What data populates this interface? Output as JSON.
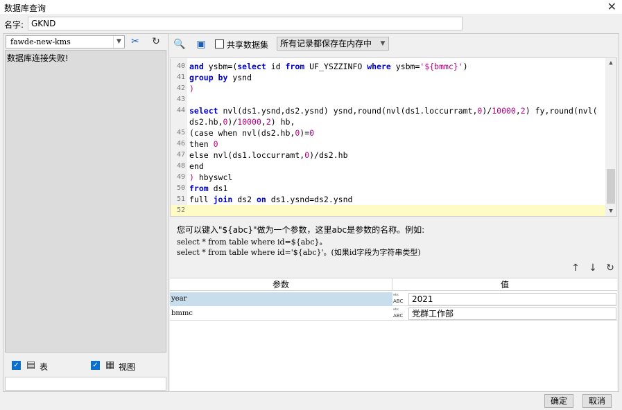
{
  "window": {
    "title": "数据库查询",
    "close_icon": "close-icon"
  },
  "name_field": {
    "label": "名字:",
    "value": "GKND"
  },
  "left": {
    "connection": "fawde-new-kms",
    "message": "数据库连接失败!",
    "table_label": "表",
    "view_label": "视图"
  },
  "toolbar": {
    "share_label": "共享数据集",
    "mode_value": "所有记录都保存在内存中"
  },
  "editor": {
    "lines": [
      {
        "n": "40",
        "html": "<span class='kw'>and</span> ysbm=(<span class='kw'>select</span> id <span class='kw'>from</span> UF_YSZZINFO <span class='kw'>where</span> ysbm=<span class='str'>'${bmmc}'</span>)"
      },
      {
        "n": "41",
        "html": "<span class='kw'>group by</span> ysnd"
      },
      {
        "n": "42",
        "html": "<span class='str'>)</span>"
      },
      {
        "n": "43",
        "html": ""
      },
      {
        "n": "44",
        "html": "<span class='kw'>select</span> nvl(ds1.ysnd,ds2.ysnd) ysnd,round(nvl(ds1.loccurramt,<span class='num'>0</span>)/<span class='num'>10000</span>,<span class='num'>2</span>) fy,round(nvl("
      },
      {
        "n": "",
        "html": "ds2.hb,<span class='num'>0</span>)/<span class='num'>10000</span>,<span class='num'>2</span>) hb,"
      },
      {
        "n": "45",
        "html": "(case when nvl(ds2.hb,<span class='num'>0</span>)=<span class='num'>0</span>"
      },
      {
        "n": "46",
        "html": "then <span class='num'>0</span>"
      },
      {
        "n": "47",
        "html": "else nvl(ds1.loccurramt,<span class='num'>0</span>)/ds2.hb"
      },
      {
        "n": "48",
        "html": "end"
      },
      {
        "n": "49",
        "html": "<span class='str'>)</span> hbyswcl"
      },
      {
        "n": "50",
        "html": "<span class='kw'>from</span> ds1"
      },
      {
        "n": "51",
        "html": "full <span class='kw'>join</span> ds2 <span class='kw'>on</span> ds1.ysnd=ds2.ysnd"
      },
      {
        "n": "52",
        "html": ""
      }
    ]
  },
  "hint": {
    "line1": "您可以键入\"${abc}\"做为一个参数，这里abc是参数的名称。例如:",
    "line2": "select * from table where id=${abc}。",
    "line3": "select * from table where id='${abc}'。(如果id字段为字符串类型)"
  },
  "params": {
    "col_param": "参数",
    "col_value": "值",
    "rows": [
      {
        "key": "year",
        "value": "2021"
      },
      {
        "key": "bmmc",
        "value": "党群工作部"
      }
    ]
  },
  "buttons": {
    "ok": "确定",
    "cancel": "取消"
  }
}
